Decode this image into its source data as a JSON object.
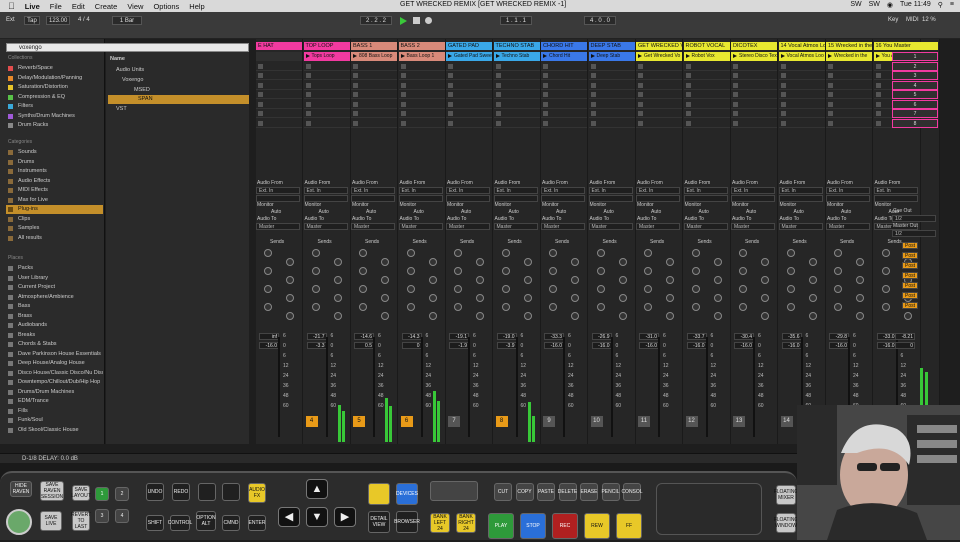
{
  "menubar": {
    "apple": "",
    "app": "Live",
    "items": [
      "File",
      "Edit",
      "Create",
      "View",
      "Options",
      "Help"
    ],
    "window_title": "GET WRECKED REMIX  [GET WRECKED REMIX -1]",
    "status_right": [
      "SW",
      "SW",
      "Tue 11:49"
    ]
  },
  "transport": {
    "ext": "Ext",
    "tap": "Tap",
    "tempo": "123.00",
    "sig": "4 / 4",
    "quant": "1 Bar",
    "position": "2 . 2 . 2",
    "loop_start": "1 . 1 . 1",
    "loop_len": "4 . 0 . 0",
    "key_label": "Key",
    "midi_label": "MIDI",
    "cpu": "12 %"
  },
  "browser": {
    "search": "voxengo",
    "collections_title": "Collections",
    "collections": [
      {
        "label": "Reverb/Space",
        "color": "#e24d4d"
      },
      {
        "label": "Delay/Modulation/Panning",
        "color": "#e8892a"
      },
      {
        "label": "Saturation/Distortion",
        "color": "#e8c52a"
      },
      {
        "label": "Compression & EQ",
        "color": "#58c248"
      },
      {
        "label": "Filters",
        "color": "#3aa8d8"
      },
      {
        "label": "Synths/Drum Machines",
        "color": "#a05ad8"
      },
      {
        "label": "Drum Racks",
        "color": "#888888"
      }
    ],
    "categories_title": "Categories",
    "categories": [
      "Sounds",
      "Drums",
      "Instruments",
      "Audio Effects",
      "MIDI Effects",
      "Max for Live",
      "Plug-ins",
      "Clips",
      "Samples",
      "All results"
    ],
    "selected_category": "Plug-ins",
    "places_title": "Places",
    "places": [
      "Packs",
      "User Library",
      "Current Project",
      "Atmosphere/Ambience",
      "Bass",
      "Brass",
      "Audiobands",
      "Breaks",
      "Chords & Stabs",
      "Dave Parkinson House Essentials",
      "Deep House/Analog House",
      "Disco House/Classic Disco/Nu Disco",
      "Downtempo/Chillout/Dub/Hip Hop",
      "Drums/Drum Machines",
      "EDM/Trance",
      "Fills",
      "Funk/Soul",
      "Old Skool/Classic House",
      "Future House"
    ],
    "name_header": "Name",
    "tree": [
      "Audio Units",
      "Voxengo",
      "MSED",
      "SPAN",
      "VST"
    ],
    "selected_tree": "SPAN"
  },
  "tracks": [
    {
      "name": "E HAT",
      "color": "#f23aa0",
      "clip": "",
      "num": "",
      "vol": "inf",
      "vol2": "-16.0",
      "active": false
    },
    {
      "name": "TOP LOOP",
      "color": "#f23aa0",
      "clip": "Tops Loop",
      "num": "4",
      "vol": "-21.7",
      "vol2": "-3.3",
      "active": true
    },
    {
      "name": "BASS 1",
      "color": "#d88a7a",
      "clip": "808 Bass Loop",
      "num": "5",
      "vol": "-14.6",
      "vol2": "0.5",
      "active": true
    },
    {
      "name": "BASS 2",
      "color": "#d88a7a",
      "clip": "Bass Loop 1",
      "num": "6",
      "vol": "-14.3",
      "vol2": "0",
      "active": true
    },
    {
      "name": "GATED PAD",
      "color": "#3aa8e8",
      "clip": "Gated Pad Sweep",
      "num": "7",
      "vol": "-19.1",
      "vol2": "-1.9",
      "active": false
    },
    {
      "name": "TECHNO STAB",
      "color": "#3aa8e8",
      "clip": "Techno Stab",
      "num": "8",
      "vol": "-19.0",
      "vol2": "-3.9",
      "active": true
    },
    {
      "name": "CHORD HIT",
      "color": "#3a78e8",
      "clip": "Chord Hit",
      "num": "9",
      "vol": "-33.3",
      "vol2": "-16.0",
      "active": false
    },
    {
      "name": "DEEP STAB",
      "color": "#3a78e8",
      "clip": "Deep Stab",
      "num": "10",
      "vol": "-26.9",
      "vol2": "-16.0",
      "active": false
    },
    {
      "name": "GET WRECKED VO",
      "color": "#e8e830",
      "clip": "Get Wrecked Vo",
      "num": "11",
      "vol": "-31.0",
      "vol2": "-16.0",
      "active": false
    },
    {
      "name": "ROBOT VOCAL",
      "color": "#e8e830",
      "clip": "Robot Vox",
      "num": "12",
      "vol": "-33.7",
      "vol2": "-16.0",
      "active": false
    },
    {
      "name": "DICOTEX",
      "color": "#e8e830",
      "clip": "Stereo Disco Tex",
      "num": "13",
      "vol": "-30.4",
      "vol2": "-16.0",
      "active": false
    },
    {
      "name": "14 Vocal Atmos Lo",
      "color": "#e8e830",
      "clip": "Vocal Atmos Loo",
      "num": "14",
      "vol": "-35.6",
      "vol2": "-16.0",
      "active": false
    },
    {
      "name": "15 Wrecked in the",
      "color": "#e8e830",
      "clip": "Wrecked in the",
      "num": "",
      "vol": "-29.8",
      "vol2": "-16.0",
      "active": false
    },
    {
      "name": "16 You And",
      "color": "#e8e830",
      "clip": "You And",
      "num": "",
      "vol": "-33.0",
      "vol2": "-16.0",
      "active": false
    }
  ],
  "master": {
    "name": "Master",
    "scenes": [
      "1",
      "2",
      "3",
      "4",
      "5",
      "6",
      "7",
      "8"
    ],
    "vol": "-8.21",
    "vol2": "0",
    "cue_out": "Cue Out",
    "cue_val": "1/2",
    "master_out": "Master Out",
    "master_val": "1/2"
  },
  "strip": {
    "audio_from": "Audio From",
    "ext_in": "Ext. In",
    "monitor": "Monitor",
    "in": "In",
    "auto": "Auto",
    "off": "Off",
    "audio_to": "Audio To",
    "master": "Master",
    "sends": "Sends",
    "send_letters": [
      "A",
      "B",
      "C",
      "D",
      "E",
      "F",
      "G",
      "H"
    ],
    "scale": [
      "6",
      "0",
      "6",
      "12",
      "24",
      "36",
      "48",
      "60"
    ],
    "post": "Post"
  },
  "status": {
    "text": "D-1/8 DELAY: 0.0 dB"
  },
  "controller": {
    "hide_raven": "HIDE RAVEN",
    "save_raven": "SAVE RAVEN SESSION",
    "save_layout": "SAVE LAYOUT",
    "save_live": "SAVE LIVE",
    "revert": "REVERT TO LAST",
    "n1": "1",
    "n2": "2",
    "n3": "3",
    "n4": "4",
    "undo": "UNDO",
    "redo": "REDO",
    "shift": "SHIFT",
    "control": "CONTROL",
    "option": "OPTION ALT",
    "cmnd": "CMND",
    "enter": "ENTER",
    "audio_fx": "AUDIO FX",
    "detail": "DETAIL VIEW",
    "browser": "BROWSER",
    "devices": "DEVICES",
    "bank_left": "BANK LEFT 24",
    "bank_right": "BANK RIGHT 24",
    "cut": "CUT",
    "copy": "COPY",
    "paste": "PASTE",
    "delete": "DELETE",
    "erase": "ERASE",
    "pencil": "PENCIL",
    "consol": "CONSOL",
    "play": "PLAY",
    "stop": "STOP",
    "rec": "REC",
    "rew": "REW",
    "ff": "FF",
    "floating_mixer": "FLOATING MIXER",
    "floating_window": "FLOATING WINDOW",
    "hide": "HIDE"
  }
}
